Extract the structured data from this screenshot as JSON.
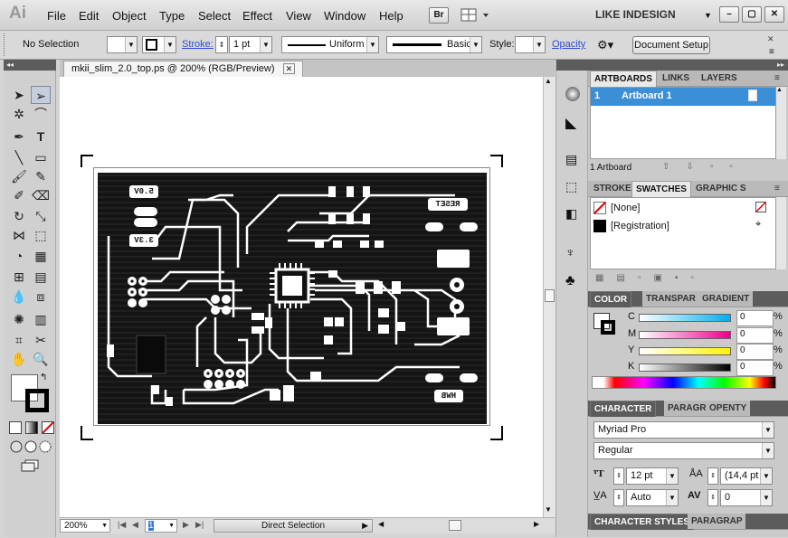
{
  "app": {
    "logo": "Ai",
    "br_label": "Br",
    "workspace": "LIKE INDESIGN"
  },
  "menu": [
    "File",
    "Edit",
    "Object",
    "Type",
    "Select",
    "Effect",
    "View",
    "Window",
    "Help"
  ],
  "control": {
    "selection": "No Selection",
    "stroke_label": "Stroke:",
    "stroke_value": "1 pt",
    "profile_uniform": "Uniform",
    "brush_basic": "Basic",
    "style_label": "Style:",
    "opacity_label": "Opacity",
    "doc_setup": "Document Setup"
  },
  "document": {
    "tab_title": "mkii_slim_2.0_top.ps @ 200% (RGB/Preview)",
    "zoom": "200%",
    "page": "1",
    "status": "Direct Selection"
  },
  "pcb_labels": {
    "v5": "5.0V",
    "v33": "3.3V",
    "reset": "RESET",
    "hwb": "HWB"
  },
  "artboards": {
    "tabs": [
      "ARTBOARDS",
      "LINKS",
      "LAYERS"
    ],
    "item_num": "1",
    "item_name": "Artboard 1",
    "count": "1 Artboard"
  },
  "swatches": {
    "tabs": [
      "STROKE",
      "SWATCHES",
      "GRAPHIC S"
    ],
    "items": [
      "[None]",
      "[Registration]"
    ]
  },
  "color": {
    "tabs": [
      "COLOR",
      "TRANSPAR",
      "GRADIENT"
    ],
    "channels": [
      {
        "name": "C",
        "value": "0",
        "unit": "%"
      },
      {
        "name": "M",
        "value": "0",
        "unit": "%"
      },
      {
        "name": "Y",
        "value": "0",
        "unit": "%"
      },
      {
        "name": "K",
        "value": "0",
        "unit": "%"
      }
    ]
  },
  "character": {
    "tabs": [
      "CHARACTER",
      "PARAGR",
      "OPENTY"
    ],
    "font_family": "Myriad Pro",
    "font_style": "Regular",
    "size": "12 pt",
    "leading": "(14,4 pt",
    "kerning": "Auto",
    "tracking": "0"
  },
  "bottom_panel": {
    "tabs": [
      "CHARACTER STYLES",
      "PARAGRAP"
    ]
  },
  "colors": {
    "accent": "#3b8fd6",
    "pcb": "#111111"
  }
}
